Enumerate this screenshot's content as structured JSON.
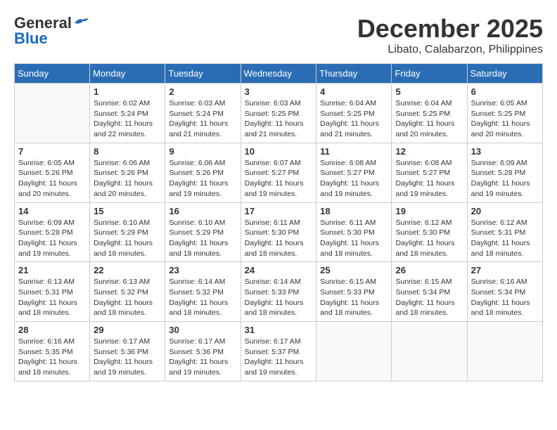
{
  "header": {
    "logo_general": "General",
    "logo_blue": "Blue",
    "title": "December 2025",
    "subtitle": "Libato, Calabarzon, Philippines"
  },
  "days_of_week": [
    "Sunday",
    "Monday",
    "Tuesday",
    "Wednesday",
    "Thursday",
    "Friday",
    "Saturday"
  ],
  "weeks": [
    [
      {
        "day": "",
        "info": ""
      },
      {
        "day": "1",
        "info": "Sunrise: 6:02 AM\nSunset: 5:24 PM\nDaylight: 11 hours\nand 22 minutes."
      },
      {
        "day": "2",
        "info": "Sunrise: 6:03 AM\nSunset: 5:24 PM\nDaylight: 11 hours\nand 21 minutes."
      },
      {
        "day": "3",
        "info": "Sunrise: 6:03 AM\nSunset: 5:25 PM\nDaylight: 11 hours\nand 21 minutes."
      },
      {
        "day": "4",
        "info": "Sunrise: 6:04 AM\nSunset: 5:25 PM\nDaylight: 11 hours\nand 21 minutes."
      },
      {
        "day": "5",
        "info": "Sunrise: 6:04 AM\nSunset: 5:25 PM\nDaylight: 11 hours\nand 20 minutes."
      },
      {
        "day": "6",
        "info": "Sunrise: 6:05 AM\nSunset: 5:25 PM\nDaylight: 11 hours\nand 20 minutes."
      }
    ],
    [
      {
        "day": "7",
        "info": "Sunrise: 6:05 AM\nSunset: 5:26 PM\nDaylight: 11 hours\nand 20 minutes."
      },
      {
        "day": "8",
        "info": "Sunrise: 6:06 AM\nSunset: 5:26 PM\nDaylight: 11 hours\nand 20 minutes."
      },
      {
        "day": "9",
        "info": "Sunrise: 6:06 AM\nSunset: 5:26 PM\nDaylight: 11 hours\nand 19 minutes."
      },
      {
        "day": "10",
        "info": "Sunrise: 6:07 AM\nSunset: 5:27 PM\nDaylight: 11 hours\nand 19 minutes."
      },
      {
        "day": "11",
        "info": "Sunrise: 6:08 AM\nSunset: 5:27 PM\nDaylight: 11 hours\nand 19 minutes."
      },
      {
        "day": "12",
        "info": "Sunrise: 6:08 AM\nSunset: 5:27 PM\nDaylight: 11 hours\nand 19 minutes."
      },
      {
        "day": "13",
        "info": "Sunrise: 6:09 AM\nSunset: 5:28 PM\nDaylight: 11 hours\nand 19 minutes."
      }
    ],
    [
      {
        "day": "14",
        "info": "Sunrise: 6:09 AM\nSunset: 5:28 PM\nDaylight: 11 hours\nand 19 minutes."
      },
      {
        "day": "15",
        "info": "Sunrise: 6:10 AM\nSunset: 5:29 PM\nDaylight: 11 hours\nand 18 minutes."
      },
      {
        "day": "16",
        "info": "Sunrise: 6:10 AM\nSunset: 5:29 PM\nDaylight: 11 hours\nand 18 minutes."
      },
      {
        "day": "17",
        "info": "Sunrise: 6:11 AM\nSunset: 5:30 PM\nDaylight: 11 hours\nand 18 minutes."
      },
      {
        "day": "18",
        "info": "Sunrise: 6:11 AM\nSunset: 5:30 PM\nDaylight: 11 hours\nand 18 minutes."
      },
      {
        "day": "19",
        "info": "Sunrise: 6:12 AM\nSunset: 5:30 PM\nDaylight: 11 hours\nand 18 minutes."
      },
      {
        "day": "20",
        "info": "Sunrise: 6:12 AM\nSunset: 5:31 PM\nDaylight: 11 hours\nand 18 minutes."
      }
    ],
    [
      {
        "day": "21",
        "info": "Sunrise: 6:13 AM\nSunset: 5:31 PM\nDaylight: 11 hours\nand 18 minutes."
      },
      {
        "day": "22",
        "info": "Sunrise: 6:13 AM\nSunset: 5:32 PM\nDaylight: 11 hours\nand 18 minutes."
      },
      {
        "day": "23",
        "info": "Sunrise: 6:14 AM\nSunset: 5:32 PM\nDaylight: 11 hours\nand 18 minutes."
      },
      {
        "day": "24",
        "info": "Sunrise: 6:14 AM\nSunset: 5:33 PM\nDaylight: 11 hours\nand 18 minutes."
      },
      {
        "day": "25",
        "info": "Sunrise: 6:15 AM\nSunset: 5:33 PM\nDaylight: 11 hours\nand 18 minutes."
      },
      {
        "day": "26",
        "info": "Sunrise: 6:15 AM\nSunset: 5:34 PM\nDaylight: 11 hours\nand 18 minutes."
      },
      {
        "day": "27",
        "info": "Sunrise: 6:16 AM\nSunset: 5:34 PM\nDaylight: 11 hours\nand 18 minutes."
      }
    ],
    [
      {
        "day": "28",
        "info": "Sunrise: 6:16 AM\nSunset: 5:35 PM\nDaylight: 11 hours\nand 18 minutes."
      },
      {
        "day": "29",
        "info": "Sunrise: 6:17 AM\nSunset: 5:36 PM\nDaylight: 11 hours\nand 19 minutes."
      },
      {
        "day": "30",
        "info": "Sunrise: 6:17 AM\nSunset: 5:36 PM\nDaylight: 11 hours\nand 19 minutes."
      },
      {
        "day": "31",
        "info": "Sunrise: 6:17 AM\nSunset: 5:37 PM\nDaylight: 11 hours\nand 19 minutes."
      },
      {
        "day": "",
        "info": ""
      },
      {
        "day": "",
        "info": ""
      },
      {
        "day": "",
        "info": ""
      }
    ]
  ]
}
